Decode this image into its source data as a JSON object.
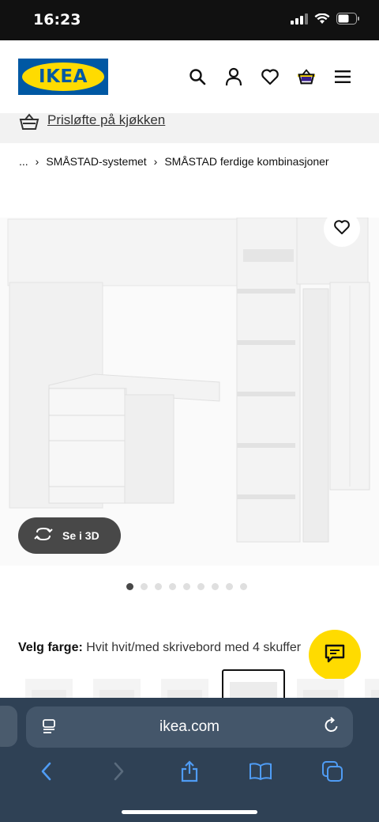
{
  "status_bar": {
    "time": "16:23"
  },
  "header": {
    "logo_text": "IKEA",
    "icons": [
      "search-icon",
      "account-icon",
      "heart-icon",
      "basket-icon",
      "menu-icon"
    ]
  },
  "promo": {
    "text": "Prisløfte på kjøkken"
  },
  "breadcrumb": {
    "items": [
      "...",
      "SMÅSTAD-systemet",
      "SMÅSTAD ferdige kombinasjoner"
    ]
  },
  "product": {
    "view_3d_label": "Se i 3D",
    "carousel": {
      "count": 9,
      "active_index": 0
    }
  },
  "color": {
    "label": "Velg farge:",
    "value": "Hvit hvit/med skrivebord med 4 skuffer"
  },
  "browser": {
    "url": "ikea.com"
  },
  "colors": {
    "ikea_blue": "#0058a3",
    "ikea_yellow": "#ffdb00",
    "browser_bar": "#2f4155"
  }
}
